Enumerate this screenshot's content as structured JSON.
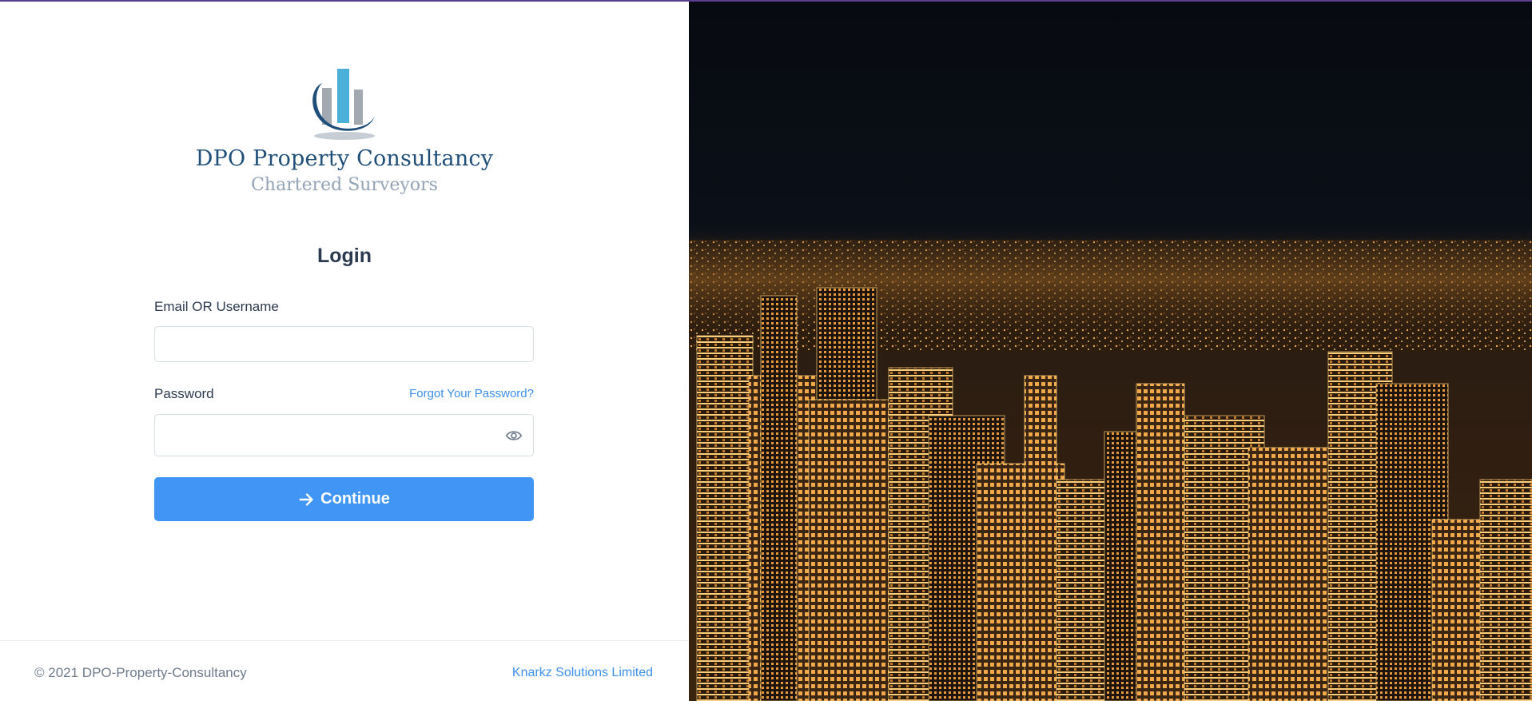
{
  "brand": {
    "name": "DPO Property Consultancy",
    "tagline": "Chartered Surveyors",
    "colors": {
      "primary": "#1f4f79",
      "accent": "#4ab0d8",
      "muted": "#93a3b5"
    }
  },
  "form": {
    "title": "Login",
    "email_label": "Email OR Username",
    "email_value": "",
    "email_placeholder": "",
    "password_label": "Password",
    "password_value": "",
    "password_placeholder": "",
    "forgot_label": "Forgot Your Password?",
    "toggle_icon": "eye-icon",
    "submit_label": "Continue",
    "submit_icon": "arrow-right-icon",
    "submit_color": "#4095f5"
  },
  "footer": {
    "copyright": "© 2021 DPO-Property-Consultancy",
    "vendor": "Knarkz Solutions Limited"
  },
  "background": {
    "icon": "city-night-skyline-image"
  }
}
